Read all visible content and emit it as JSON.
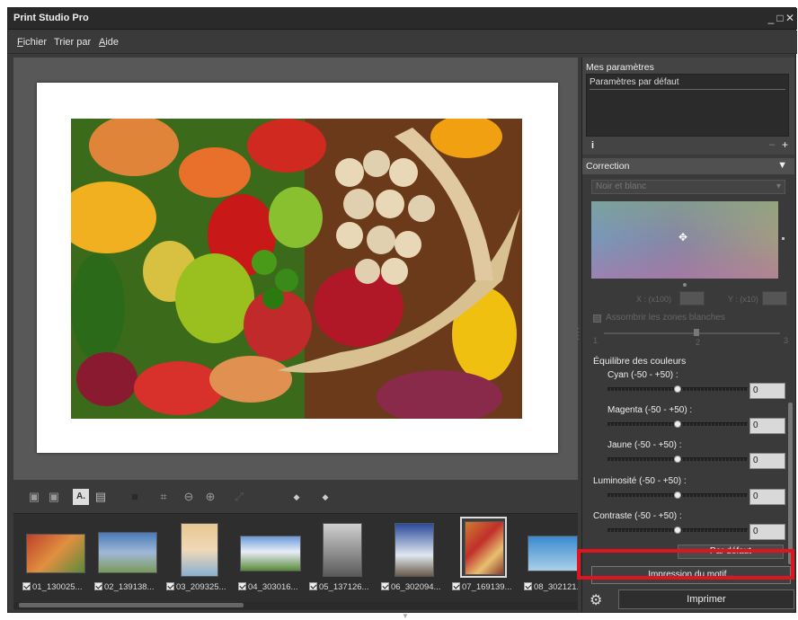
{
  "app": {
    "title": "Print Studio Pro"
  },
  "window_controls": {
    "minimize": "_",
    "maximize": "□",
    "close": "✕"
  },
  "menu": {
    "items": [
      {
        "label": "Fichier",
        "accel": "F"
      },
      {
        "label": "Trier par",
        "accel": ""
      },
      {
        "label": "Aide",
        "accel": "A"
      }
    ]
  },
  "toolbar": {
    "icons": [
      "layout-1-icon",
      "layout-2-icon",
      "text-icon",
      "image-tool-icon",
      "rect-icon",
      "crop-icon",
      "zoom-out-icon",
      "zoom-in-icon",
      "fit-icon",
      "arrow-left-icon",
      "arrow-right-icon"
    ],
    "glyphs": [
      "▣",
      "▣",
      "A",
      "▤",
      "■",
      "⌗",
      "⊖",
      "⊕",
      "⤢",
      "◆",
      "◆"
    ],
    "text_label": "A."
  },
  "thumbnails": [
    {
      "label": "01_130025...",
      "checked": true,
      "colors": [
        "#c0402a",
        "#5a8a3a"
      ]
    },
    {
      "label": "02_139138...",
      "checked": true,
      "colors": [
        "#4a7ab8",
        "#7a9a5a"
      ]
    },
    {
      "label": "03_209325...",
      "checked": true,
      "colors": [
        "#e8c890",
        "#f0d8b8"
      ]
    },
    {
      "label": "04_303016...",
      "checked": true,
      "colors": [
        "#6a9ad8",
        "#5a8a3a"
      ]
    },
    {
      "label": "05_137126...",
      "checked": true,
      "colors": [
        "#cfcfcf",
        "#6a6a6a"
      ]
    },
    {
      "label": "06_302094...",
      "checked": true,
      "colors": [
        "#2a4a9a",
        "#e0e8f0"
      ]
    },
    {
      "label": "07_169139...",
      "checked": true,
      "colors": [
        "#d07a30",
        "#8a3a2a"
      ],
      "selected": true
    },
    {
      "label": "08_302121...",
      "checked": true,
      "colors": [
        "#3a8ad0",
        "#aad0e8"
      ]
    }
  ],
  "right_panel": {
    "my_settings": {
      "title": "Mes paramètres",
      "item": "Paramètres par défaut",
      "info": "i",
      "minus": "–",
      "plus": "+"
    },
    "correction": {
      "title": "Correction",
      "arrow": "▼",
      "mode": "Noir et blanc",
      "x_label": "X : (x100)",
      "y_label": "Y : (x10)",
      "white_zones": "Assombrir les zones blanches",
      "slider_min": "1",
      "slider_mid": "2",
      "slider_max": "3"
    },
    "color_balance": {
      "title": "Équilibre des couleurs",
      "sliders": [
        {
          "label": "Cyan (-50 - +50) :",
          "value": "0"
        },
        {
          "label": "Magenta (-50 - +50) :",
          "value": "0"
        },
        {
          "label": "Jaune (-50 - +50) :",
          "value": "0"
        },
        {
          "label": "Luminosité (-50 - +50) :",
          "value": "0"
        },
        {
          "label": "Contraste (-50 - +50) :",
          "value": "0"
        }
      ]
    },
    "default_button": "Par défaut",
    "pattern_button": "Impression du motif...",
    "print_button": "Imprimer"
  }
}
